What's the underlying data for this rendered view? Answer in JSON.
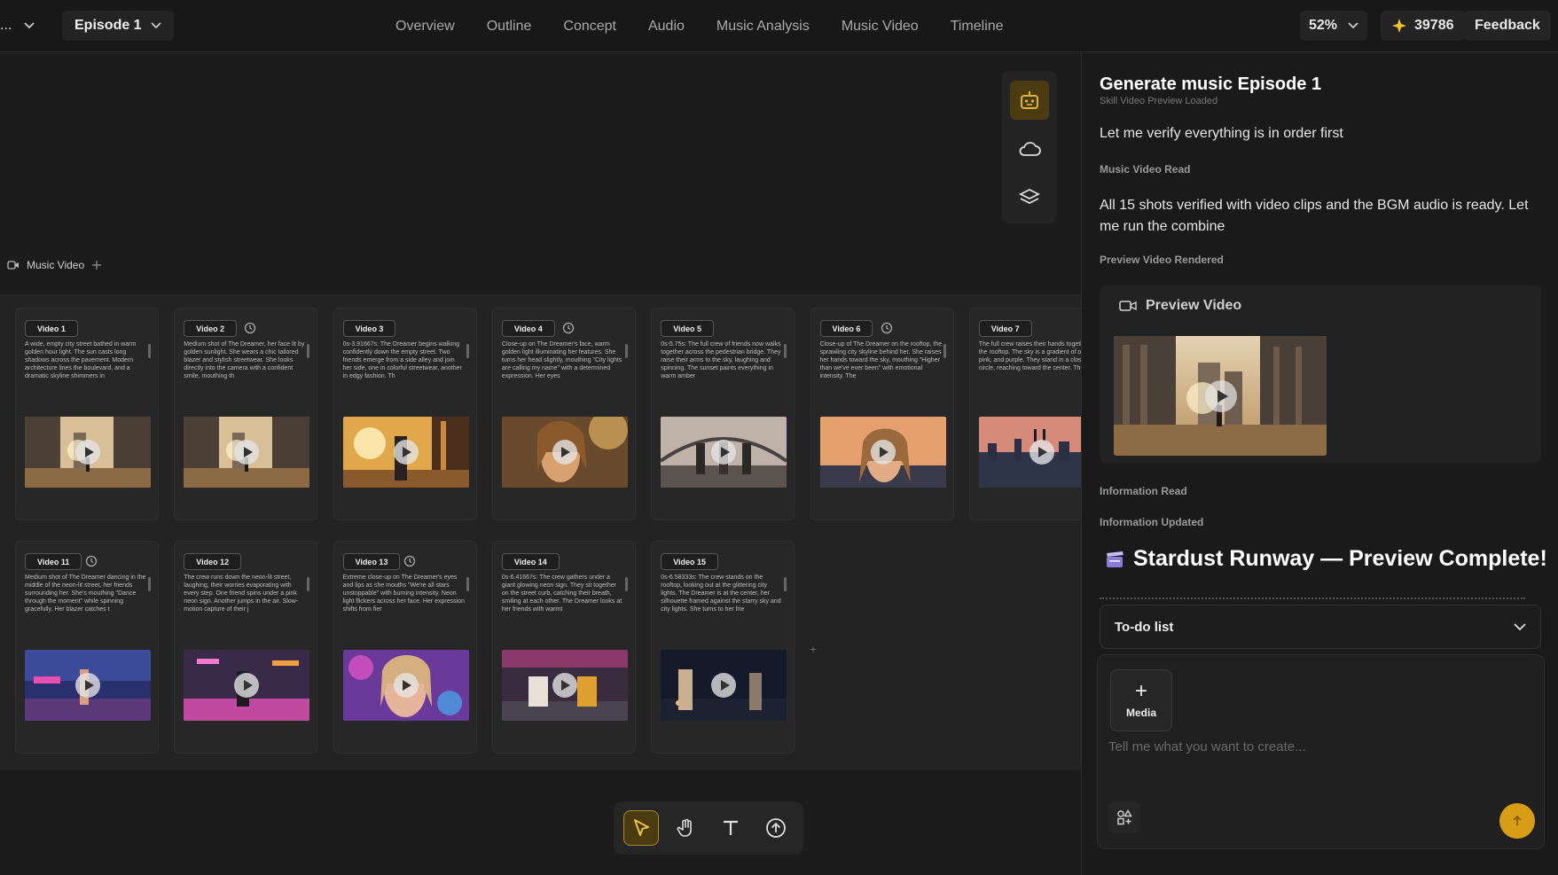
{
  "topbar": {
    "project_label": "...",
    "episode_label": "Episode 1",
    "nav": [
      "Overview",
      "Outline",
      "Concept",
      "Audio",
      "Music Analysis",
      "Music Video",
      "Timeline"
    ],
    "zoom": "52%",
    "credits": "39786",
    "feedback": "Feedback"
  },
  "canvas": {
    "frame_label": "Music Video",
    "cards_row1": [
      {
        "label": "Video 1",
        "desc": "A wide, empty city street bathed in warm golden hour light. The sun casts long shadows across the pavement. Modern architecture lines the boulevard, and a dramatic skyline shimmers in",
        "has_status": false,
        "scene": "street"
      },
      {
        "label": "Video 2",
        "desc": "Medium shot of The Dreamer, her face lit by golden sunlight. She wears a chic tailored blazer and stylish streetwear. She looks directly into the camera with a confident smile, mouthing th",
        "has_status": true,
        "scene": "street"
      },
      {
        "label": "Video 3",
        "desc": "0s-3.91667s: The Dreamer begins walking confidently down the empty street. Two friends emerge from a side alley and join her side, one in colorful streetwear, another in edgy fashion. Th",
        "has_status": false,
        "scene": "walk"
      },
      {
        "label": "Video 4",
        "desc": "Close-up on The Dreamer's face, warm golden light illuminating her features. She turns her head slightly, mouthing \"City lights are calling my name\" with a determined expression. Her eyes",
        "has_status": true,
        "scene": "face"
      },
      {
        "label": "Video 5",
        "desc": "0s-5.75s: The full crew of friends now walks together across the pedestrian bridge. They raise their arms to the sky, laughing and spinning. The sunset paints everything in warm amber",
        "has_status": false,
        "scene": "bridge"
      },
      {
        "label": "Video 6",
        "desc": "Close-up of The Dreamer on the rooftop, the sprawling city skyline behind her. She raises her hands toward the sky, mouthing \"Higher than we've ever been\" with emotional intensity. The",
        "has_status": true,
        "scene": "rooftop"
      },
      {
        "label": "Video 7",
        "desc": "The full crew raises their hands together on the rooftop. The sky is a gradient of orange, pink, and purple. They stand in a close circle, reaching toward the center. The f",
        "has_status": false,
        "scene": "skyline"
      }
    ],
    "cards_row2": [
      {
        "label": "Video 11",
        "desc": "Medium shot of The Dreamer dancing in the middle of the neon-lit street, her friends surrounding her. She's mouthing \"Dance through the moment\" while spinning gracefully. Her blazer catches t",
        "has_status": true,
        "scene": "neon"
      },
      {
        "label": "Video 12",
        "desc": "The crew runs down the neon-lit street, laughing, their worries evaporating with every step. One friend spins under a pink neon sign. Another jumps in the air. Slow-motion capture of their j",
        "has_status": false,
        "scene": "neonrun"
      },
      {
        "label": "Video 13",
        "desc": "Extreme close-up on The Dreamer's eyes and lips as she mouths \"We're all stars unstoppable\" with burning intensity. Neon light flickers across her face. Her expression shifts from fier",
        "has_status": true,
        "scene": "neonface"
      },
      {
        "label": "Video 14",
        "desc": "0s-6.41667s: The crew gathers under a giant glowing neon sign. They sit together on the street curb, catching their breath, smiling at each other. The Dreamer looks at her friends with warmt",
        "has_status": false,
        "scene": "curb"
      },
      {
        "label": "Video 15",
        "desc": "0s-6.58333s: The crew stands on the rooftop, looking out at the glittering city lights. The Dreamer is at the center, her silhouette framed against the starry sky and city lights. She turns to her frie",
        "has_status": false,
        "scene": "night"
      }
    ]
  },
  "panel": {
    "title": "Generate music Episode 1",
    "ghost_line": "Skill Video Preview Loaded",
    "text1": "Let me verify everything is in order first",
    "label1": "Music Video Read",
    "text2": "All 15 shots verified with video clips and the BGM audio is ready. Let me run the combine",
    "label2": "Preview Video Rendered",
    "preview_label": "Preview Video",
    "label3": "Information Read",
    "label4": "Information Updated",
    "headline": "Stardust Runway — Preview Complete!",
    "todo": "To-do list",
    "media": "Media",
    "placeholder": "Tell me what you want to create..."
  },
  "colors": {
    "accent": "#d79d16",
    "bg": "#1c1c1c",
    "panel": "#1a1a1a"
  }
}
